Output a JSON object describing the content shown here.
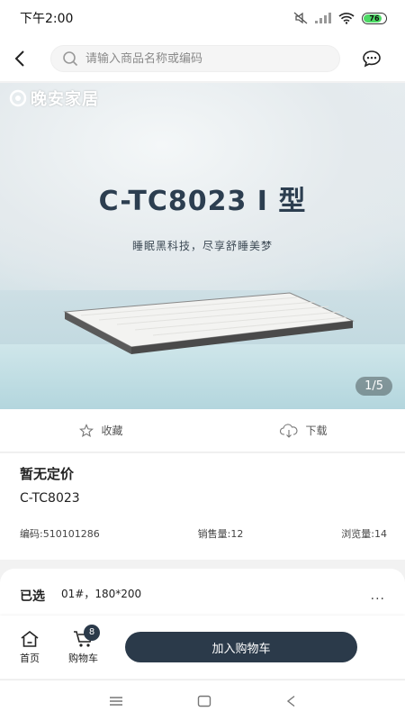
{
  "status_bar": {
    "time": "下午2:00",
    "battery": "76"
  },
  "search": {
    "placeholder": "请输入商品名称或编码"
  },
  "banner": {
    "brand": "晚安家居",
    "title": "C-TC8023 I 型",
    "tagline": "睡眠黑科技，尽享舒睡美梦",
    "page_indicator": "1/5"
  },
  "actions": {
    "favorite_label": "收藏",
    "download_label": "下载"
  },
  "product": {
    "price": "暂无定价",
    "model": "C-TC8023",
    "code": "编码:510101286",
    "sales": "销售量:12",
    "views": "浏览量:14"
  },
  "spec": {
    "label": "已选",
    "value": "01#，180*200",
    "more": "..."
  },
  "bottom_bar": {
    "home_label": "首页",
    "cart_label": "购物车",
    "cart_count": "8",
    "add_to_cart_label": "加入购物车"
  },
  "colors": {
    "primary": "#2b3a4a",
    "battery": "#4cd964"
  },
  "icons": [
    "back-arrow-icon",
    "search-icon",
    "message-icon",
    "star-icon",
    "cloud-download-icon",
    "home-icon",
    "cart-icon",
    "menu-icon",
    "square-icon",
    "triangle-back-icon"
  ]
}
